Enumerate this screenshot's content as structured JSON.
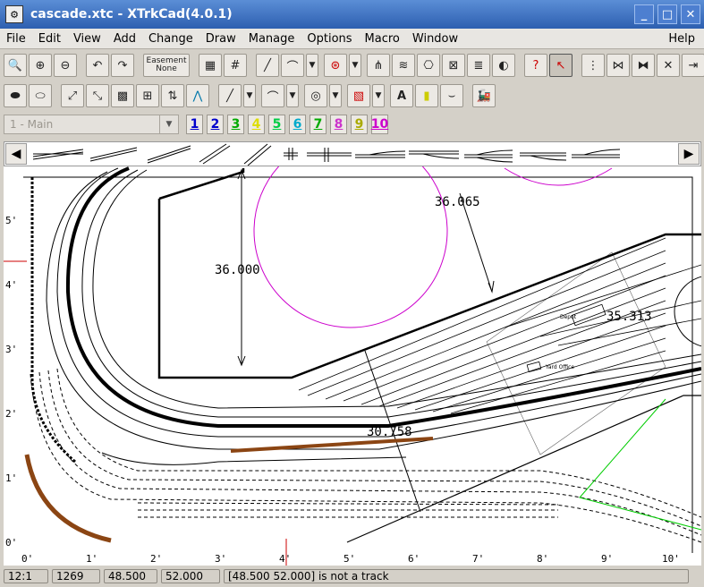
{
  "window": {
    "title": "cascade.xtc - XTrkCad(4.0.1)",
    "minimize": "_",
    "maximize": "□",
    "close": "✕"
  },
  "menu": [
    "File",
    "Edit",
    "View",
    "Add",
    "Change",
    "Draw",
    "Manage",
    "Options",
    "Macro",
    "Window"
  ],
  "menu_help": "Help",
  "toolbar": {
    "easement_line1": "Easement",
    "easement_line2": "None"
  },
  "layers": {
    "current": "1 - Main",
    "buttons": [
      "1",
      "2",
      "3",
      "4",
      "5",
      "6",
      "7",
      "8",
      "9",
      "10"
    ],
    "colors": [
      "#0000cc",
      "#0000cc",
      "#00aa00",
      "#e0e000",
      "#00cc44",
      "#00aacc",
      "#00aa00",
      "#cc33cc",
      "#aaaa00",
      "#cc00cc"
    ]
  },
  "canvas": {
    "dimensions": [
      "36.065",
      "36.000",
      "30.758",
      "35.313"
    ],
    "y_ticks": [
      "5'",
      "4'",
      "3'",
      "2'",
      "1'",
      "0'"
    ],
    "x_ticks": [
      "0'",
      "1'",
      "2'",
      "3'",
      "4'",
      "5'",
      "6'",
      "7'",
      "8'",
      "9'",
      "10'"
    ],
    "labels": [
      "Yard Office",
      "Depot"
    ]
  },
  "status": {
    "scale": "12:1",
    "count": "1269",
    "x": "48.500",
    "y": "52.000",
    "message": "[48.500 52.000] is not a track"
  }
}
